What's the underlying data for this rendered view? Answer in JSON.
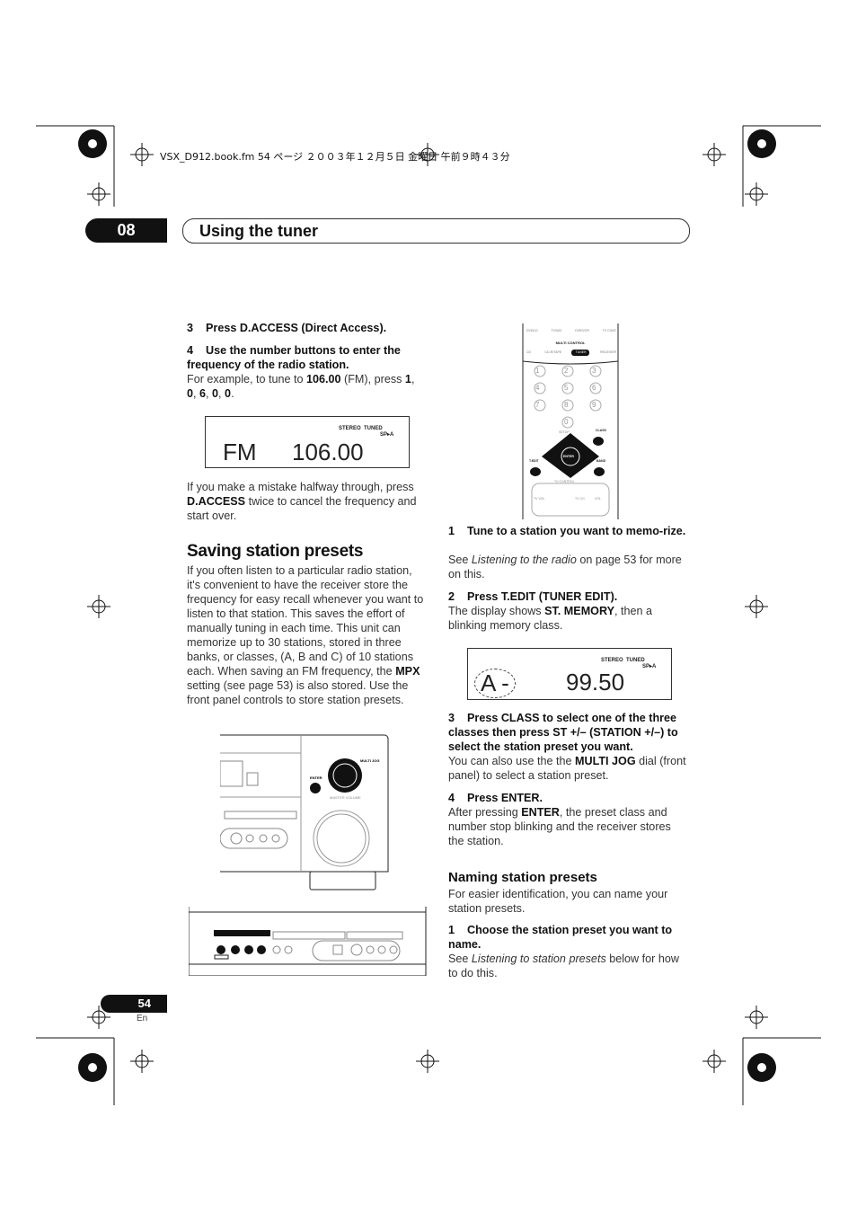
{
  "crop_line": "VSX_D912.book.fm  54 ページ  ２００３年１２月５日  金曜日  午前９時４３分",
  "header": {
    "chapter": "08",
    "title": "Using the tuner"
  },
  "left": {
    "step3": {
      "num": "3",
      "text": "Press D.ACCESS (Direct Access)."
    },
    "step4": {
      "num": "4",
      "text": "Use the number buttons to enter the frequency of the radio station."
    },
    "example": [
      "For example, to tune to ",
      "106.00",
      " (FM), press ",
      "1",
      ", ",
      "0",
      ", ",
      "6",
      ", ",
      "0",
      ", ",
      "0",
      "."
    ],
    "display1": {
      "band": "FM",
      "freq": "106.00",
      "stereo": "STEREO",
      "tuned": "TUNED",
      "sp": "SP▸A"
    },
    "mistake": [
      "If you make a mistake halfway through, press ",
      "D.ACCESS",
      " twice to cancel the frequency and start over."
    ],
    "saving_title": "Saving station presets",
    "saving_text": [
      "If you often listen to a particular radio station, it's convenient to have the receiver store the frequency for easy recall whenever you want to listen to that station. This saves the effort of manually tuning in each time. This unit can memorize up to 30 stations, stored in three banks, or classes, (A, B and C) of 10 stations each. When saving an FM frequency, the ",
      "MPX",
      " setting (see page 53) is also stored. Use the front panel controls to store station presets."
    ],
    "front_panel": {
      "multi_jog": "MULTI JOG",
      "enter": "ENTER",
      "master_volume": "MASTER VOLUME"
    }
  },
  "remote": {
    "row1": [
      "DVD/LD",
      "TV/SAT",
      "DVR/VCR",
      "TV CONT"
    ],
    "multi_control": "MULTI CONTROL",
    "row2": [
      "CD",
      "CD-R/TAPE",
      "TUNER",
      "RECEIVER"
    ],
    "numbers": [
      "1",
      "2",
      "3",
      "4",
      "5",
      "6",
      "7",
      "8",
      "9",
      "0"
    ],
    "labels": {
      "enter": "ENTER",
      "class": "CLASS",
      "tedit": "T.EDIT",
      "band": "BAND",
      "setup": "SETUP",
      "tv_control": "TV CONTROL",
      "vol": "VOL",
      "tv_vol": "TV VOL",
      "tv_ch": "TV CH"
    }
  },
  "right": {
    "step1": {
      "num": "1",
      "text": "Tune to a station you want to memo-rize."
    },
    "step1_text": [
      "See ",
      "Listening to the radio",
      " on page 53 for more on this."
    ],
    "step2": {
      "num": "2",
      "text": "Press T.EDIT (TUNER EDIT)."
    },
    "step2_text": [
      "The display shows ",
      "ST. MEMORY",
      ", then a blinking memory class."
    ],
    "display2": {
      "class": "A -",
      "freq": "99.50",
      "stereo": "STEREO",
      "tuned": "TUNED",
      "sp": "SP▸A"
    },
    "step3": {
      "num": "3",
      "text": "Press CLASS to select one of the three classes then press ST +/– (STATION +/–) to select the station preset you want."
    },
    "step3_text": [
      "You can also use the the ",
      "MULTI JOG",
      " dial (front panel) to select a station preset."
    ],
    "step4": {
      "num": "4",
      "text": "Press ENTER."
    },
    "step4_text": [
      "After pressing ",
      "ENTER",
      ", the preset class and number stop blinking and the receiver stores the station."
    ],
    "naming_title": "Naming station presets",
    "naming_text": "For easier identification, you can name your station presets.",
    "nstep1": {
      "num": "1",
      "text": "Choose the station preset you want to name."
    },
    "nstep1_text": [
      "See ",
      "Listening to station presets",
      " below for how to do this."
    ]
  },
  "footer": {
    "page": "54",
    "lang": "En"
  }
}
